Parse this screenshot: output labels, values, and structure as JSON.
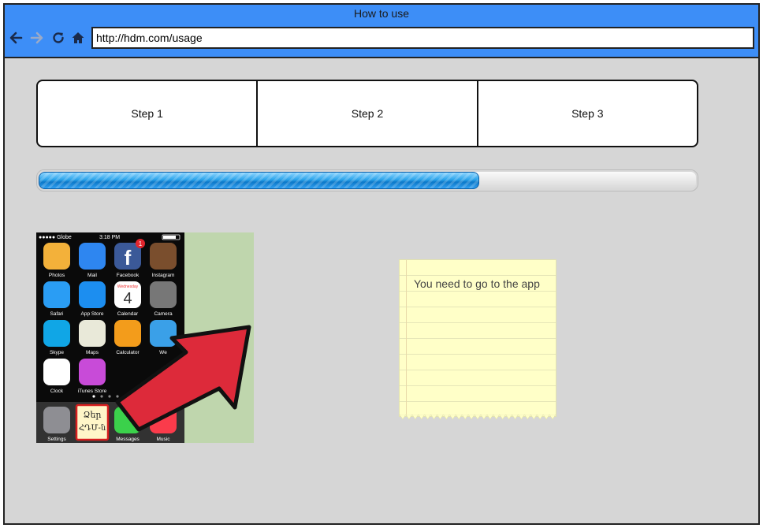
{
  "window": {
    "title": "How to use"
  },
  "toolbar": {
    "back_icon": "arrow-left-icon",
    "forward_icon": "arrow-right-icon",
    "reload_icon": "reload-icon",
    "home_icon": "home-icon",
    "url": "http://hdm.com/usage"
  },
  "steps": [
    {
      "label": "Step 1"
    },
    {
      "label": "Step 2"
    },
    {
      "label": "Step 3"
    }
  ],
  "progress": {
    "value": 0.67
  },
  "image": {
    "description_icon": "phone-homescreen-image",
    "status_carrier": "●●●●● Globe",
    "status_time": "3:18 PM",
    "apps": [
      {
        "label": "Photos"
      },
      {
        "label": "Mail"
      },
      {
        "label": "Facebook"
      },
      {
        "label": "Instagram"
      },
      {
        "label": "Safari"
      },
      {
        "label": "App Store"
      },
      {
        "label": "Calendar"
      },
      {
        "label": "Camera"
      },
      {
        "label": "Skype"
      },
      {
        "label": "Maps"
      },
      {
        "label": "Calculator"
      },
      {
        "label": "We"
      },
      {
        "label": "Clock"
      },
      {
        "label": "iTunes Store"
      }
    ],
    "dock": [
      {
        "label": "Settings"
      },
      {
        "label": ""
      },
      {
        "label": "Messages"
      },
      {
        "label": "Music"
      }
    ],
    "badge": "1",
    "calendar_day": "4",
    "calendar_weekday": "Wednesday",
    "highlight_text_1": "Ձեր",
    "highlight_text_2": "ՀԴՄ-ն"
  },
  "note": {
    "text": "You need to go to the app"
  },
  "colors": {
    "titlebar": "#3d8ef7",
    "background": "#d6d6d6",
    "note": "#ffffc8",
    "progress": "#2aa3ea"
  }
}
